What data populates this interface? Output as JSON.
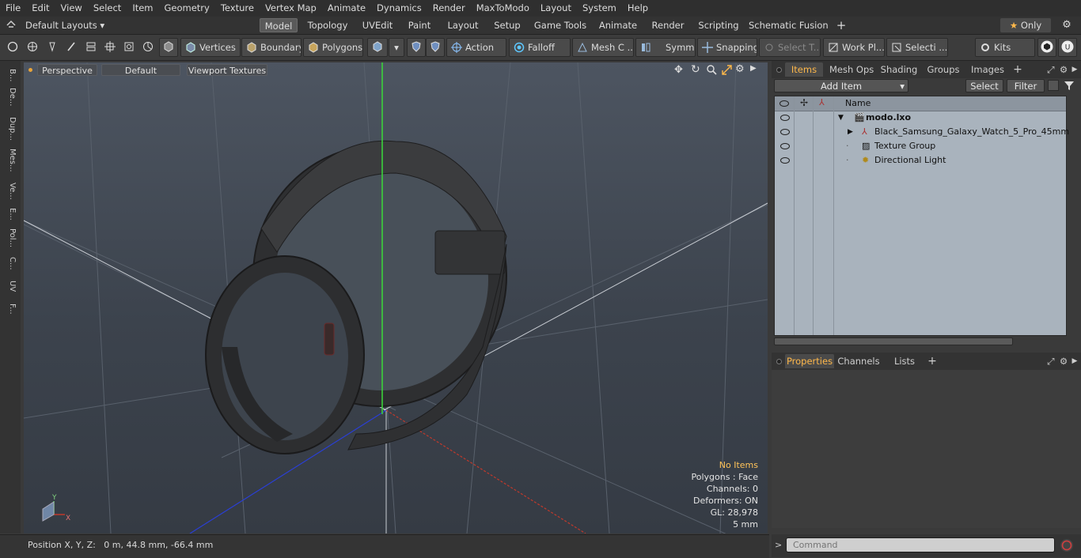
{
  "menubar": {
    "items": [
      "File",
      "Edit",
      "View",
      "Select",
      "Item",
      "Geometry",
      "Texture",
      "Vertex Map",
      "Animate",
      "Dynamics",
      "Render",
      "MaxToModo",
      "Layout",
      "System",
      "Help"
    ]
  },
  "layoutbar": {
    "layouts_dropdown": "Default Layouts",
    "tabs": [
      "Model",
      "Topology",
      "UVEdit",
      "Paint",
      "Layout",
      "Setup",
      "Game Tools",
      "Animate",
      "Render",
      "Scripting",
      "Schematic Fusion"
    ],
    "active_tab": "Model",
    "only_label": "Only"
  },
  "toolbar": {
    "vertices": "Vertices",
    "boundary": "Boundary",
    "polygons": "Polygons",
    "action": "Action",
    "falloff": "Falloff",
    "mesh": "Mesh C ...",
    "symmetry": "Symm ...",
    "snapping": "Snapping",
    "select_t": "Select T...",
    "work_plane": "Work Pl...",
    "selection": "Selecti ...",
    "kits": "Kits"
  },
  "leftstrip": {
    "tabs": [
      "B...",
      "De...",
      "Dup...",
      "Mes...",
      "Ve...",
      "E...",
      "Pol...",
      "C...",
      "UV",
      "F..."
    ]
  },
  "viewport": {
    "perspective": "Perspective",
    "default": "Default",
    "textures": "Viewport Textures",
    "hud": {
      "no_items": "No Items",
      "polygons": "Polygons : Face",
      "channels": "Channels: 0",
      "deformers": "Deformers: ON",
      "gl": "GL: 28,978",
      "scale": "5 mm"
    },
    "axis_labels": {
      "x": "X",
      "y": "Y"
    }
  },
  "statusbar": {
    "position": "Position X, Y, Z:   0 m, 44.8 mm, -66.4 mm"
  },
  "items_panel": {
    "tabs": [
      "Items",
      "Mesh Ops",
      "Shading",
      "Groups",
      "Images"
    ],
    "active_tab": "Items",
    "add_item": "Add Item",
    "select": "Select",
    "filter": "Filter",
    "name_header": "Name",
    "rows": [
      {
        "label": "modo.lxo",
        "bold": true
      },
      {
        "label": "Black_Samsung_Galaxy_Watch_5_Pro_45mm",
        "bold": false
      },
      {
        "label": "Texture Group",
        "bold": false
      },
      {
        "label": "Directional Light",
        "bold": false
      }
    ]
  },
  "properties_panel": {
    "tabs": [
      "Properties",
      "Channels",
      "Lists"
    ],
    "active_tab": "Properties"
  },
  "command": {
    "placeholder": "Command"
  },
  "colors": {
    "accent": "#ffb84a",
    "y_axis": "#3bd13b",
    "x_axis": "#c0392b",
    "z_axis": "#2a3fd6"
  }
}
